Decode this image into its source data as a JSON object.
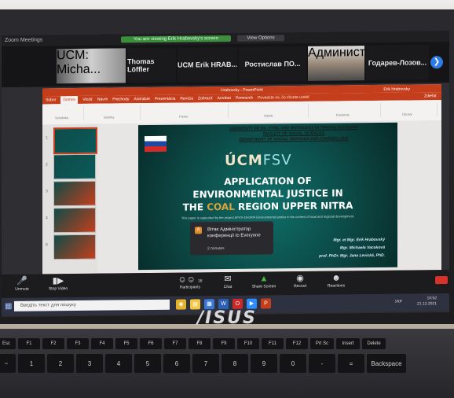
{
  "zoom": {
    "window_title": "Zoom Meetings",
    "notice": "You are viewing Erik Hrabovsky's screen",
    "view_options": "View Options",
    "participants": [
      {
        "name": "Thomas Löffler"
      },
      {
        "name": "UCM Erik HRAB..."
      },
      {
        "name": "Ростислав ПО..."
      },
      {
        "name": "Годарев-Лозов..."
      }
    ],
    "self_video_label": "UCM: Micha...",
    "admin_label": "Администрат...",
    "toolbar": [
      {
        "label": "Unmute",
        "icon": "microphone-off-icon"
      },
      {
        "label": "Stop Video",
        "icon": "video-camera-icon"
      },
      {
        "label": "Participants",
        "icon": "participants-icon",
        "count": "16"
      },
      {
        "label": "Chat",
        "icon": "chat-icon"
      },
      {
        "label": "Share Screen",
        "icon": "share-screen-icon"
      },
      {
        "label": "Record",
        "icon": "record-icon"
      },
      {
        "label": "Reactions",
        "icon": "reactions-icon"
      }
    ],
    "toast": {
      "icon_letter": "A",
      "message": "Вітає Адміністратор конференції to Everyone",
      "subtext": "2 minutes"
    }
  },
  "powerpoint": {
    "title": "Hrabovsky - PowerPoint",
    "search_hint": "Povedzte mi, čo chcete urobiť",
    "user": "Erik Hrabovsky",
    "menu": [
      "Súbor",
      "Domov",
      "Vložiť",
      "Návrh",
      "Prechody",
      "Animácie",
      "Prezentácia",
      "Revízia",
      "Zobraziť",
      "Acrobat",
      "Pomocník"
    ],
    "active_menu": "Domov",
    "share": "Zdieľať",
    "ribbon_groups": [
      "Schránka",
      "Snímky",
      "Písmo",
      "Odsek",
      "Kreslenie",
      "Úpravy"
    ],
    "thumb_numbers": [
      "1",
      "2",
      "3",
      "4",
      "5",
      "6"
    ],
    "slide": {
      "header_lines": [
        "UNIVERSITY OF SS. CYRIL AND METHODIUS IN TRNAVA, SLOVAKIA",
        "FACULTY OF SOCIAL SCIENCES",
        "DEPARTMENT OF SOCIAL SERVICES AND COUNSELLING"
      ],
      "logo_main": "ÚCM",
      "logo_sub": "FSV",
      "title_line1": "APPLICATION OF",
      "title_line2": "ENVIRONMENTAL JUSTICE IN",
      "title_line3_a": "THE",
      "title_line3_b": "COAL",
      "title_line3_c": "REGION UPPER NITRA",
      "note": "This paper is supported by the project APVV-18-0004 Environmental justice in the context of local and regional development.",
      "authors": [
        "Mgr. et Mgr. Erik Hrabovský",
        "Mgr. Michaela Vacaková",
        "prof. PhDr. Mgr. Jana Levická, PhD."
      ]
    }
  },
  "windows": {
    "search_placeholder": "Введіть текст для пошуку",
    "taskbar_icons": [
      "chrome-icon",
      "file-explorer-icon",
      "store-icon",
      "word-icon",
      "opera-icon",
      "zoom-icon",
      "powerpoint-icon"
    ],
    "lang": "УКР",
    "time": "10:52",
    "date": "21.12.2021"
  },
  "laptop": {
    "brand": "/ISUS",
    "keys_row1": [
      "Esc",
      "F1",
      "F2",
      "F3",
      "F4",
      "F5",
      "F6",
      "F7",
      "F8",
      "F9",
      "F10",
      "F11",
      "F12",
      "Prt Sc",
      "Insert",
      "Delete"
    ],
    "keys_row2": [
      "~",
      "1",
      "2",
      "3",
      "4",
      "5",
      "6",
      "7",
      "8",
      "9",
      "0",
      "-",
      "=",
      "Backspace"
    ]
  }
}
